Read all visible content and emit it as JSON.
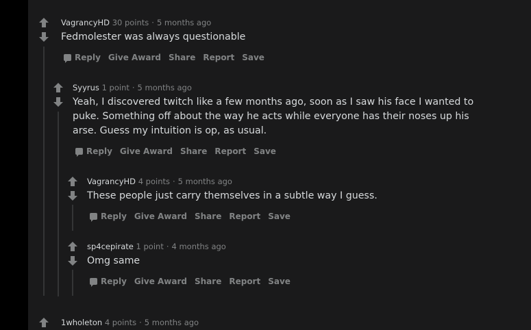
{
  "comments": [
    {
      "author": "VagrancyHD",
      "points": "30 points",
      "time": "5 months ago",
      "body": "Fedmolester was always questionable"
    },
    {
      "author": "Syyrus",
      "points": "1 point",
      "time": "5 months ago",
      "body": "Yeah, I discovered twitch like a few months ago, soon as I saw his face I wanted to puke. Something off about the way he acts while everyone has their noses up his arse. Guess my intuition is op, as usual."
    },
    {
      "author": "VagrancyHD",
      "points": "4 points",
      "time": "5 months ago",
      "body": "These people just carry themselves in a subtle way I guess."
    },
    {
      "author": "sp4cepirate",
      "points": "1 point",
      "time": "4 months ago",
      "body": "Omg same"
    },
    {
      "author": "1wholeton",
      "points": "4 points",
      "time": "5 months ago"
    }
  ],
  "actions": {
    "reply": "Reply",
    "give_award": "Give Award",
    "share": "Share",
    "report": "Report",
    "save": "Save"
  },
  "colors": {
    "page_bg": "#000000",
    "panel_bg": "#1a1a1b",
    "text": "#d7dadc",
    "muted": "#818384",
    "thread_line": "#343536"
  },
  "icons": {
    "upvote": "arrow-up-icon",
    "downvote": "arrow-down-icon",
    "reply": "speech-bubble-icon"
  }
}
